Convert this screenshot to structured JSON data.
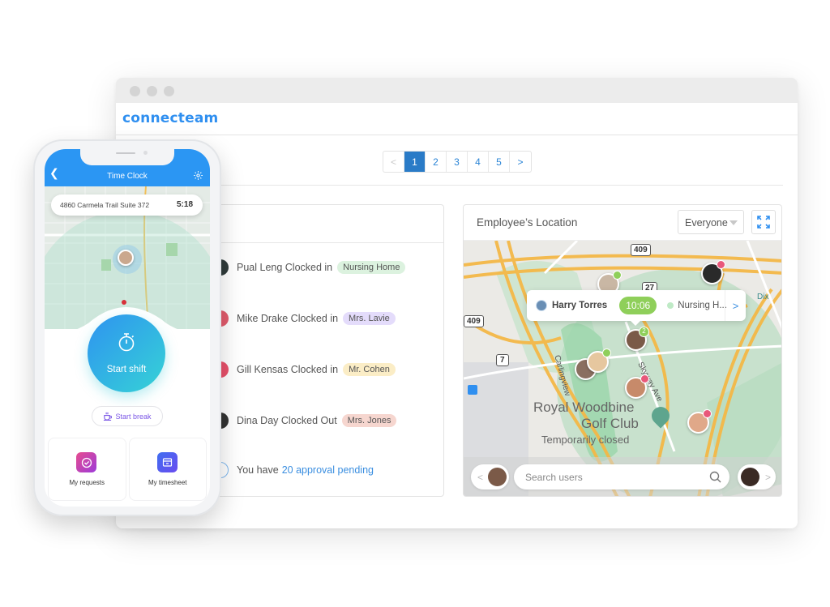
{
  "browser": {
    "brand": "connecteam"
  },
  "pagination": {
    "prev": "<",
    "pages": [
      "1",
      "2",
      "3",
      "4",
      "5"
    ],
    "active_page": "1",
    "next": ">"
  },
  "activity": {
    "items": [
      {
        "text": "Pual Leng Clocked in",
        "tag": "Nursing Home",
        "tag_color": "#dcf2df",
        "avatar_color": "#2f3b3a"
      },
      {
        "text": "Mike Drake Clocked in",
        "tag": "Mrs. Lavie",
        "tag_color": "#e4dcfb",
        "avatar_color": "#e25b6c"
      },
      {
        "text": "Gill Kensas Clocked in",
        "tag": "Mr. Cohen",
        "tag_color": "#fbedc6",
        "avatar_color": "#e8506a"
      },
      {
        "text": "Dina Day Clocked Out",
        "tag": "Mrs. Jones",
        "tag_color": "#f6d6cf",
        "avatar_color": "#333333"
      }
    ],
    "pending_prefix": "You have",
    "pending_link": "20 approval pending"
  },
  "location": {
    "title": "Employee’s Location",
    "filter_value": "Everyone",
    "tooltip": {
      "name": "Harry Torres",
      "time": "10:06",
      "location": "Nursing H...",
      "chevron": ">"
    },
    "map_labels": {
      "road_409_top": "409",
      "road_409_left": "409",
      "road_27": "27",
      "road_7": "7",
      "street_carlingview": "Carlingview",
      "street_skyway": "Skyway Ave",
      "place_name_1": "Royal Woodbine",
      "place_name_2": "Golf Club",
      "place_status": "Temporarily closed",
      "street_dix": "Dix"
    },
    "cluster_count": "2",
    "search_placeholder": "Search users",
    "prev_arrow": "<",
    "next_arrow": ">"
  },
  "phone": {
    "title": "Time Clock",
    "address": "4860 Carmela Trail Suite 372",
    "timer": "5:18",
    "start_shift": "Start shift",
    "start_break": "Start break",
    "tiles": [
      {
        "label": "My requests"
      },
      {
        "label": "My timesheet"
      }
    ]
  },
  "colors": {
    "brand": "#2f8ff0",
    "active_page": "#2a7bc7",
    "online": "#8fcf5a",
    "offline": "#e8587a",
    "break_accent": "#7b57e6"
  }
}
